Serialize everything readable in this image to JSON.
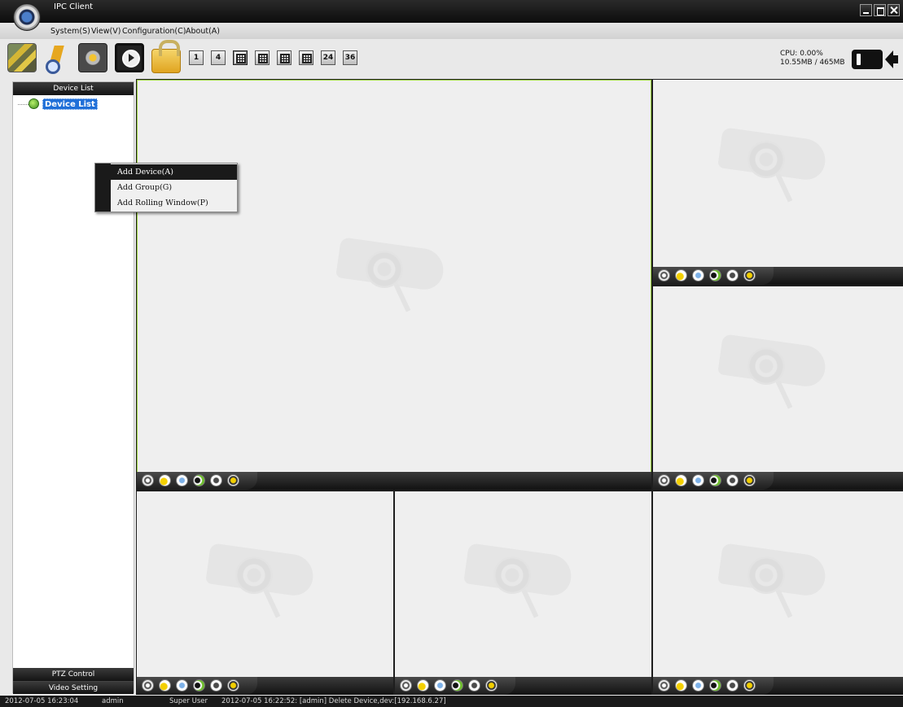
{
  "window": {
    "title": "IPC Client"
  },
  "menubar": {
    "system": "System(S)",
    "view": "View(V)",
    "configuration": "Configuration(C)",
    "about": "About(A)"
  },
  "toolbar": {
    "layouts": [
      "1",
      "4",
      "",
      "",
      "",
      "",
      "24",
      "36"
    ],
    "cpu": "CPU: 0.00%",
    "memory": "10.55MB / 465MB"
  },
  "left_panel": {
    "header": "Device List",
    "tree_root": "Device List",
    "ptz_header": "PTZ Control",
    "video_setting_header": "Video Setting"
  },
  "context_menu": {
    "items": [
      {
        "label": "Add Device(A)",
        "highlighted": true
      },
      {
        "label": "Add Group(G)",
        "highlighted": false
      },
      {
        "label": "Add Rolling Window(P)",
        "highlighted": false
      }
    ]
  },
  "status_bar": {
    "time": "2012-07-05 16:23:04",
    "user": "admin",
    "role": "Super User",
    "log": "2012-07-05 16:22:52: [admin] Delete Device,dev:[192.168.6.27]"
  },
  "video_viewports": {
    "count": 6,
    "controls": [
      "record-icon",
      "snapshot-camera-icon",
      "capture-icon",
      "audio-icon",
      "talk-icon",
      "zoom-icon"
    ]
  },
  "colors": {
    "active_border": "#9ad13c",
    "selection": "#1f6fd8"
  }
}
